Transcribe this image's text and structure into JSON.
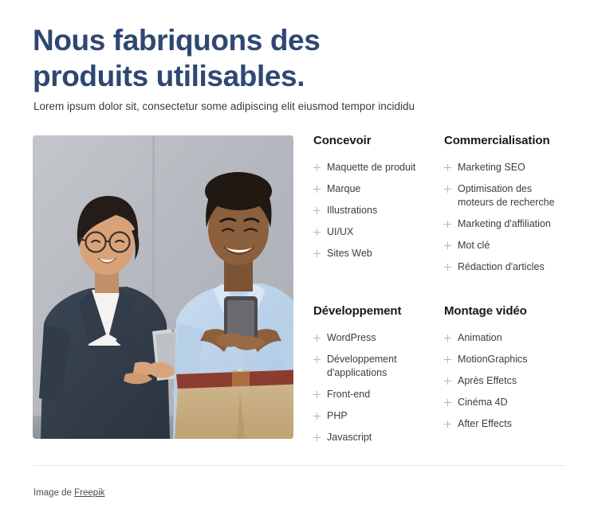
{
  "hero": {
    "title": "Nous fabriquons des produits utilisables.",
    "subtitle": "Lorem ipsum dolor sit, consectetur some adipiscing elit eiusmod tempor incididu"
  },
  "photo": {
    "alt": "Two smiling colleagues standing against a grey wall, one holding a tablet and the other a smartphone",
    "background_color": "#b9bcc2"
  },
  "colors": {
    "heading_navy": "#2f4772",
    "column_heading": "#181818",
    "body_text": "#3d3d3d",
    "plus_icon": "#b6b6b6",
    "divider": "#e9e9e9"
  },
  "services": {
    "columns": [
      {
        "heading": "Concevoir",
        "items": [
          "Maquette de produit",
          "Marque",
          "Illustrations",
          "UI/UX",
          "Sites Web"
        ]
      },
      {
        "heading": "Commercialisation",
        "items": [
          "Marketing SEO",
          "Optimisation des moteurs de recherche",
          "Marketing d'affiliation",
          "Mot clé",
          "Rédaction d'articles"
        ]
      },
      {
        "heading": "Développement",
        "items": [
          "WordPress",
          "Développement d'applications",
          "Front-end",
          "PHP",
          "Javascript"
        ]
      },
      {
        "heading": "Montage vidéo",
        "items": [
          "Animation",
          "MotionGraphics",
          "Après Effetcs",
          "Cinéma 4D",
          "After Effects"
        ]
      }
    ]
  },
  "footer": {
    "credit_prefix": "Image de ",
    "credit_link": "Freepik"
  }
}
